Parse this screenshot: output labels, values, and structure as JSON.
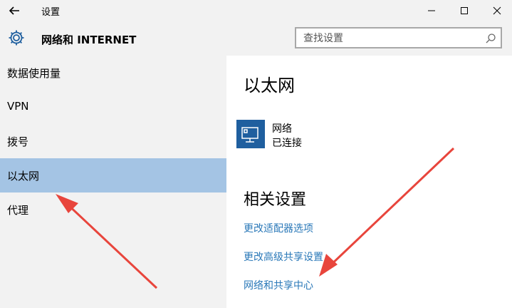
{
  "window": {
    "title": "设置"
  },
  "header": {
    "section_title": "网络和 INTERNET"
  },
  "search": {
    "placeholder": "查找设置"
  },
  "sidebar": {
    "items": [
      {
        "label": "数据使用量",
        "active": false
      },
      {
        "label": "VPN",
        "active": false
      },
      {
        "label": "拨号",
        "active": false
      },
      {
        "label": "以太网",
        "active": true
      },
      {
        "label": "代理",
        "active": false
      }
    ]
  },
  "main": {
    "title": "以太网",
    "network": {
      "name": "网络",
      "status": "已连接"
    },
    "related_title": "相关设置",
    "links": [
      "更改适配器选项",
      "更改高级共享设置",
      "网络和共享中心"
    ]
  },
  "colors": {
    "accent": "#a4c4e4",
    "link": "#2a78b8",
    "annotation": "#e8453c",
    "network_tile": "#1f5f9f"
  }
}
